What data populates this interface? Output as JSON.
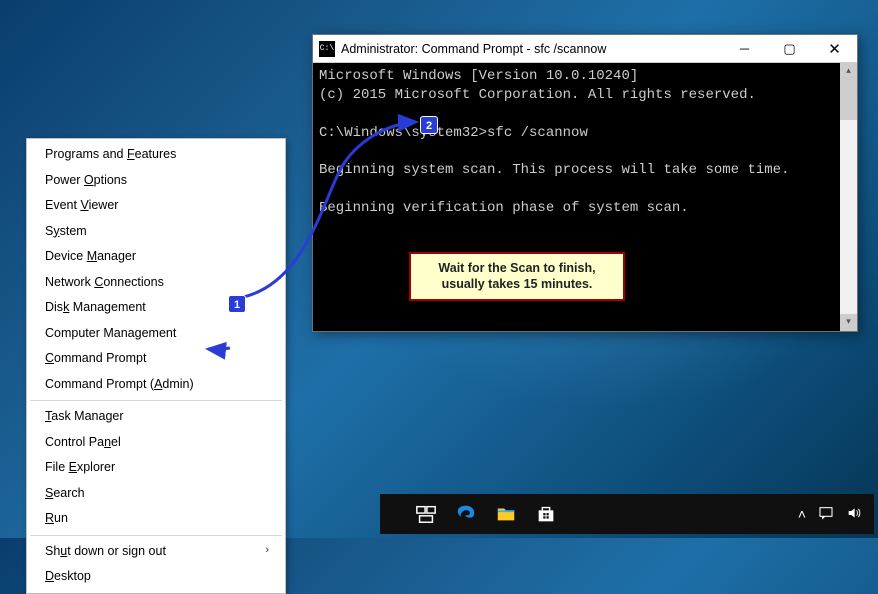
{
  "context_menu": {
    "groups": [
      [
        {
          "html": "Programs and <u>F</u>eatures"
        },
        {
          "html": "Power <u>O</u>ptions"
        },
        {
          "html": "Event <u>V</u>iewer"
        },
        {
          "html": "S<u>y</u>stem"
        },
        {
          "html": "Device <u>M</u>anager"
        },
        {
          "html": "Network <u>C</u>onnections"
        },
        {
          "html": "Dis<u>k</u> Management"
        },
        {
          "html": "Computer Mana<u>g</u>ement"
        },
        {
          "html": "<u>C</u>ommand Prompt"
        },
        {
          "html": "Command Prompt (<u>A</u>dmin)"
        }
      ],
      [
        {
          "html": "<u>T</u>ask Manager"
        },
        {
          "html": "Control Pa<u>n</u>el"
        },
        {
          "html": "File <u>E</u>xplorer"
        },
        {
          "html": "<u>S</u>earch"
        },
        {
          "html": "<u>R</u>un"
        }
      ],
      [
        {
          "html": "Sh<u>u</u>t down or sign out",
          "arrow": true
        },
        {
          "html": "<u>D</u>esktop"
        }
      ]
    ]
  },
  "cmd_window": {
    "title": "Administrator: Command Prompt - sfc /scannow",
    "lines": [
      "Microsoft Windows [Version 10.0.10240]",
      "(c) 2015 Microsoft Corporation. All rights reserved.",
      "",
      "C:\\Windows\\system32>sfc /scannow",
      "",
      "Beginning system scan.  This process will take some time.",
      "",
      "Beginning verification phase of system scan."
    ]
  },
  "callout": {
    "line1": "Wait for the Scan to finish,",
    "line2": "usually takes 15 minutes."
  },
  "steps": {
    "s1": "1",
    "s2": "2"
  }
}
